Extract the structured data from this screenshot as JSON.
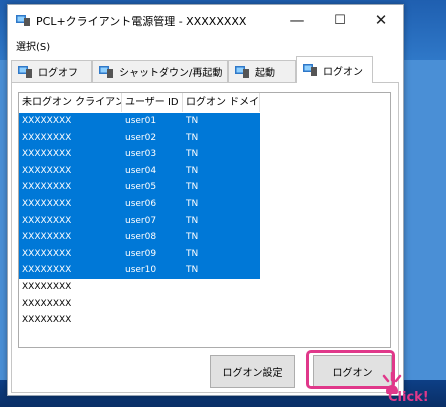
{
  "window": {
    "title": "PCL+クライアント電源管理 - XXXXXXXX",
    "minimize_glyph": "—",
    "maximize_glyph": "☐",
    "close_glyph": "✕"
  },
  "menu": {
    "select_label": "選択(S)"
  },
  "tabs": [
    {
      "label": "ログオフ",
      "icon": "monitor-icon"
    },
    {
      "label": "シャットダウン/再起動",
      "icon": "monitor-icon"
    },
    {
      "label": "起動",
      "icon": "monitor-icon"
    },
    {
      "label": "ログオン",
      "icon": "monitor-icon"
    }
  ],
  "listview": {
    "columns": [
      "未ログオン クライアント",
      "ユーザー ID",
      "ログオン ドメイン"
    ],
    "rows": [
      {
        "client": "XXXXXXXX",
        "user": "user01",
        "domain": "TN"
      },
      {
        "client": "XXXXXXXX",
        "user": "user02",
        "domain": "TN"
      },
      {
        "client": "XXXXXXXX",
        "user": "user03",
        "domain": "TN"
      },
      {
        "client": "XXXXXXXX",
        "user": "user04",
        "domain": "TN"
      },
      {
        "client": "XXXXXXXX",
        "user": "user05",
        "domain": "TN"
      },
      {
        "client": "XXXXXXXX",
        "user": "user06",
        "domain": "TN"
      },
      {
        "client": "XXXXXXXX",
        "user": "user07",
        "domain": "TN"
      },
      {
        "client": "XXXXXXXX",
        "user": "user08",
        "domain": "TN"
      },
      {
        "client": "XXXXXXXX",
        "user": "user09",
        "domain": "TN"
      },
      {
        "client": "XXXXXXXX",
        "user": "user10",
        "domain": "TN"
      },
      {
        "client": "XXXXXXXX",
        "user": "",
        "domain": ""
      },
      {
        "client": "XXXXXXXX",
        "user": "",
        "domain": ""
      },
      {
        "client": "XXXXXXXX",
        "user": "",
        "domain": ""
      }
    ]
  },
  "buttons": {
    "logon_settings": "ログオン設定",
    "logon": "ログオン"
  },
  "annotation": {
    "click_label": "Click!",
    "highlight_color": "#e0388a"
  },
  "colors": {
    "selection": "#0078d7"
  }
}
